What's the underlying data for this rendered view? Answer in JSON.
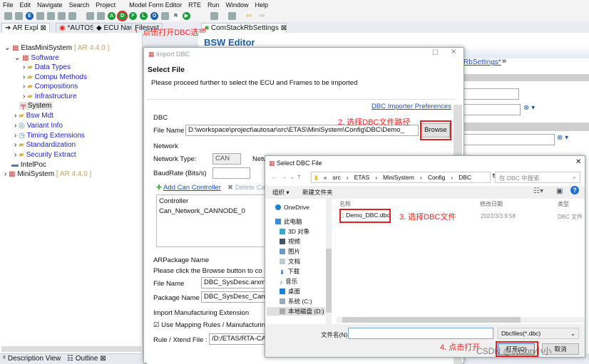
{
  "menu": [
    "File",
    "Edit",
    "Navigate",
    "Search",
    "Project",
    "Model Form Editor",
    "RTE",
    "Run",
    "Window",
    "Help"
  ],
  "toolbar": {
    "circle_icons": [
      "E",
      "A",
      "D",
      "F",
      "L",
      "O",
      "R"
    ]
  },
  "tabs": {
    "left": [
      "AR Expl",
      "*AUTOS",
      "ECU Nav",
      "Filesyst"
    ],
    "editor": "ComStackRbSettings"
  },
  "annotations": {
    "step1": "1. 点击打开DBC选项",
    "step2": "2. 选择DBC文件路径",
    "step3": "3. 选择DBC文件",
    "step4": "4. 点击打开",
    "watermark": "CSDN @Jason小小"
  },
  "tree": {
    "root": "EtasMiniSystem",
    "root_ver": "[ AR 4.4.0 ]",
    "software": "Software",
    "software_children": [
      "Data Types",
      "Compu Methods",
      "Compositions",
      "Infrastructure"
    ],
    "system": "System",
    "others": [
      "Bsw Mdt",
      "Variant Info",
      "Timing Extensions",
      "Standardization",
      "Security Extract"
    ],
    "intelpoc": "IntelPoc",
    "minisystem": "MiniSystem",
    "minisystem_ver": "[ AR 4.4.0 ]"
  },
  "editor": {
    "title": "BSW Editor",
    "breadcrumb": "RbSettings*"
  },
  "bottom_tabs": [
    "Description View",
    "Outline"
  ],
  "import_dialog": {
    "title": "Import DBC",
    "heading": "Select File",
    "description": "Please proceed further to select the ECU and Frames to be imported",
    "preferences_link": "DBC Importer Preferences",
    "dbc_group": "DBC",
    "file_name_label": "File Name",
    "file_name_value": "D:\\workspace\\project\\autosar\\src\\ETAS\\MiniSystem\\Config\\DBC\\Demo_",
    "browse": "Browse",
    "network_group": "Network",
    "network_type_label": "Network Type:",
    "network_type_value": "CAN",
    "network_name_label": "Netw",
    "baudrate_label": "BaudRate (Bits/s)",
    "baudrate_value": "",
    "add_controller": "Add Can Controller",
    "delete_controller": "Delete Ca",
    "controller_header": "Controller",
    "controllers": [
      "Can_Network_CANNODE_0"
    ],
    "arpackage_group": "ARPackage Name",
    "arpackage_hint": "Please click the Browse button to co",
    "ar_file_label": "File Name",
    "ar_file_value": "DBC_SysDesc.arxml",
    "package_label": "Package Name",
    "package_value": "DBC_SysDesc_Can_N",
    "manufacturing_group": "Import Manufacturing Extension",
    "use_mapping": "Use Mapping Rules / Manufacturin",
    "use_mapping_checked": true,
    "rule_label": "Rule / Xtend File :",
    "rule_value": "/D:/ETAS/RTA-CA"
  },
  "file_dialog": {
    "title": "Select DBC File",
    "path": [
      "«",
      "src",
      "ETAS",
      "MiniSystem",
      "Config",
      "DBC"
    ],
    "search_placeholder": "在 DBC 中搜索",
    "organize": "组织 ▾",
    "new_folder": "新建文件夹",
    "sidebar": [
      "OneDrive",
      "此电脑",
      "3D 对象",
      "视频",
      "图片",
      "文档",
      "下载",
      "音乐",
      "桌面",
      "系统 (C:)",
      "本地磁盘 (D:)"
    ],
    "columns": [
      "名称",
      "修改日期",
      "类型"
    ],
    "files": [
      {
        "name": "Demo_DBC.dbc",
        "date": "2022/3/3 9:58",
        "type": "DBC 文件"
      }
    ],
    "filename_label": "文件名(N):",
    "filename_value": "",
    "filter": "Dbcfiles(*.dbc)",
    "open": "打开(O)",
    "cancel": "取消"
  },
  "colors": {
    "accent_red": "#e52020",
    "link": "#1a4fd0",
    "tree_blue": "#2222dd",
    "green_icon": "#1a9a3a"
  }
}
